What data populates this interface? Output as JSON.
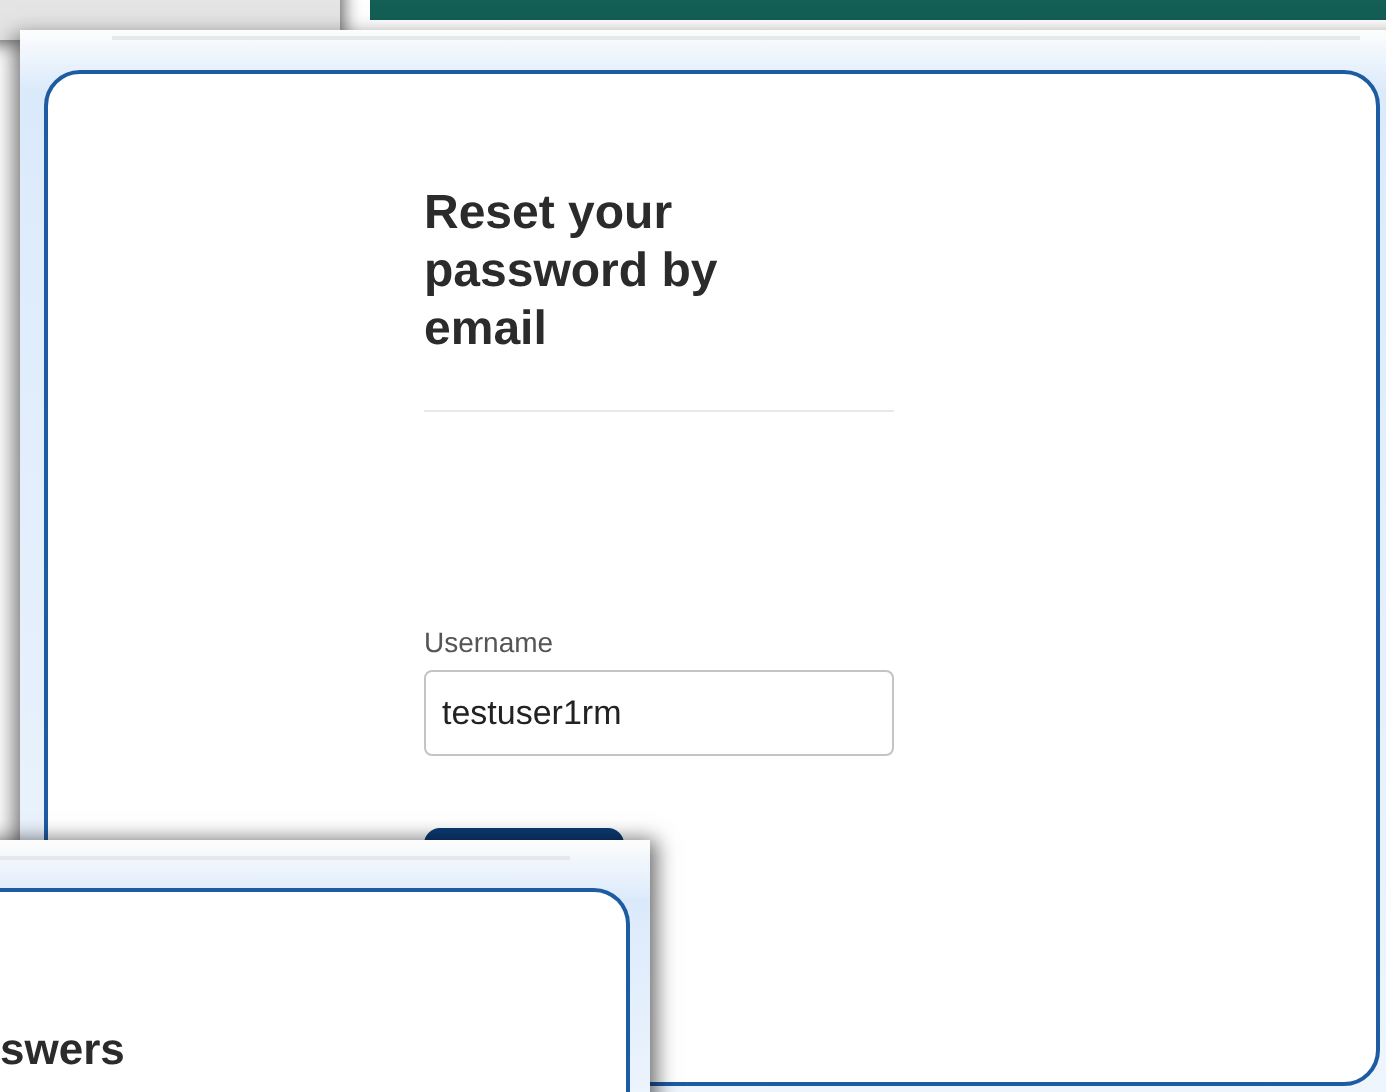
{
  "reset_window": {
    "title": "Reset your password by email",
    "username_field": {
      "label": "Username",
      "value": "testuser1rm"
    }
  },
  "front_window": {
    "heading": "swers"
  }
}
